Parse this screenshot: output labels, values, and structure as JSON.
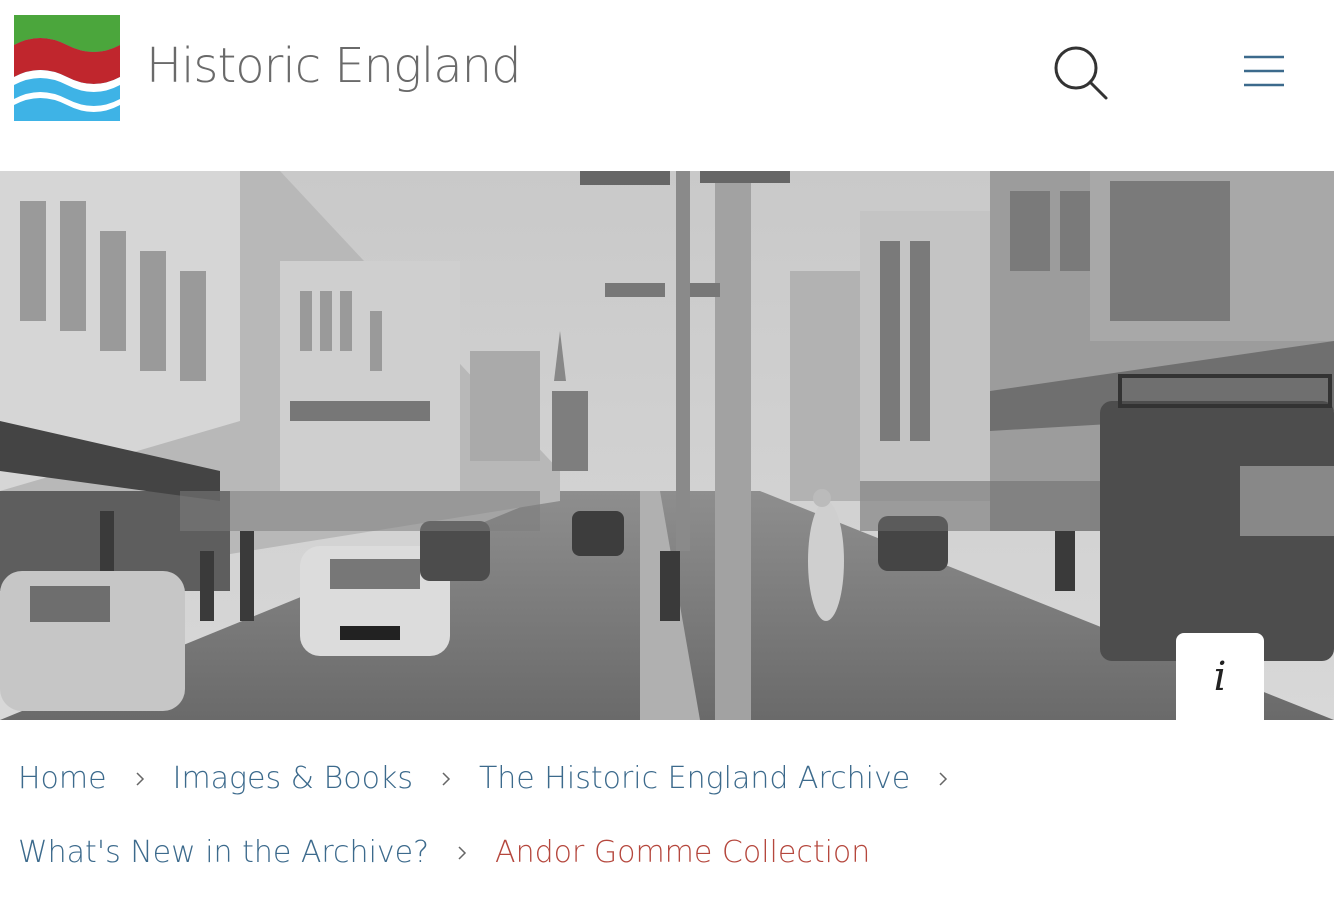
{
  "header": {
    "brand": "Historic England",
    "logo_icon": "historic-england-logo",
    "search_icon": "search-icon",
    "menu_icon": "hamburger-menu-icon"
  },
  "hero": {
    "info_label": "i"
  },
  "breadcrumb": {
    "items": [
      {
        "label": "Home"
      },
      {
        "label": "Images & Books"
      },
      {
        "label": "The Historic England Archive"
      },
      {
        "label": "What's New in the Archive?"
      },
      {
        "label": "Andor Gomme Collection"
      }
    ]
  },
  "colors": {
    "logo_green": "#4ba63c",
    "logo_red": "#c0262d",
    "logo_blue": "#3eb3e6",
    "link": "#3c6a8c",
    "current": "#b5473d"
  }
}
